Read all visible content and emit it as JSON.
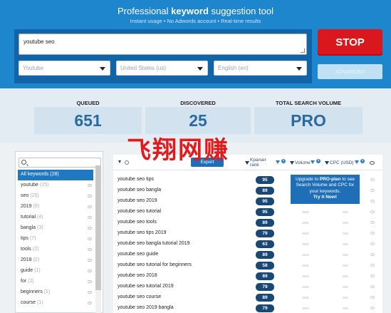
{
  "hero": {
    "title_prefix": "Professional ",
    "title_bold": "keyword",
    "title_suffix": " suggestion tool",
    "subtitle": "Instant usage   •   No Adwords account   •   Real-time results"
  },
  "search": {
    "value": "youtube seo",
    "source": "Youtube",
    "country": "United States (us)",
    "language": "English (en)",
    "stop_label": "STOP",
    "advanced_label": "ADVANCED"
  },
  "stats": {
    "queued_label": "QUEUED",
    "queued_value": "651",
    "discovered_label": "DISCOVERED",
    "discovered_value": "25",
    "volume_label": "TOTAL SEARCH VOLUME",
    "volume_value": "PRO"
  },
  "watermark": "飞翔网赚",
  "sidebar": {
    "items": [
      {
        "label": "All keywords",
        "count": "(28)"
      },
      {
        "label": "youtube",
        "count": "(25)"
      },
      {
        "label": "seo",
        "count": "(25)"
      },
      {
        "label": "2019",
        "count": "(6)"
      },
      {
        "label": "tutorial",
        "count": "(4)"
      },
      {
        "label": "bangla",
        "count": "(3)"
      },
      {
        "label": "tips",
        "count": "(7)"
      },
      {
        "label": "tools",
        "count": "(2)"
      },
      {
        "label": "2018",
        "count": "(2)"
      },
      {
        "label": "guide",
        "count": "(1)"
      },
      {
        "label": "for",
        "count": "(2)"
      },
      {
        "label": "beginners",
        "count": "(1)"
      },
      {
        "label": "course",
        "count": "(1)"
      }
    ]
  },
  "table": {
    "export_label": "Export",
    "col_rank": "Kparser rank",
    "col_volume": "Volume",
    "col_cpc": "CPC (USD)",
    "rows": [
      {
        "keyword": "youtube seo tips",
        "rank": "95"
      },
      {
        "keyword": "youtube seo bangla",
        "rank": "89"
      },
      {
        "keyword": "youtube seo 2019",
        "rank": "95"
      },
      {
        "keyword": "youtube seo tutorial",
        "rank": "95"
      },
      {
        "keyword": "youtube seo tools",
        "rank": "89"
      },
      {
        "keyword": "youtube seo tips 2019",
        "rank": "79"
      },
      {
        "keyword": "youtube seo bangla tutorial 2019",
        "rank": "63"
      },
      {
        "keyword": "youtube seo guide",
        "rank": "89"
      },
      {
        "keyword": "youtube seo tutorial for beginners",
        "rank": "58"
      },
      {
        "keyword": "youtube seo 2018",
        "rank": "89"
      },
      {
        "keyword": "youtube seo tutorial 2019",
        "rank": "79"
      },
      {
        "keyword": "youtube seo course",
        "rank": "89"
      },
      {
        "keyword": "youtube seo 2019 bangla",
        "rank": "79"
      }
    ]
  },
  "upgrade": {
    "line1_prefix": "Upgrade to ",
    "line1_bold": "PRO-plan",
    "line1_suffix": " to see",
    "line2": "Search Volume and CPC for",
    "line3": "your keywords.",
    "line4": "Try it Now!"
  },
  "colors": {
    "brand_blue": "#1e86cd",
    "panel_blue": "#1264a8",
    "stop_red": "#d9171c",
    "rank_badge": "#1a4876",
    "watermark_red": "#e31a1c"
  }
}
